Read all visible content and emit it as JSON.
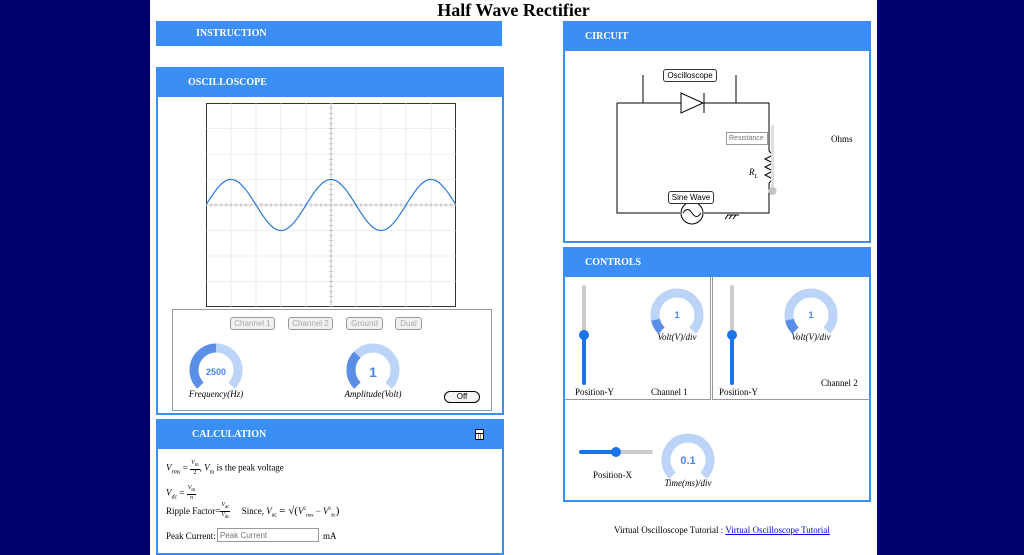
{
  "page_title": "Half Wave Rectifier",
  "instruction": {
    "title": "INSTRUCTION"
  },
  "oscilloscope": {
    "title": "OSCILLOSCOPE",
    "channel_buttons": [
      "Channel 1",
      "Channel 2",
      "Ground",
      "Dual"
    ],
    "frequency": {
      "value": "2500",
      "label": "Frequency(Hz)",
      "level": 0.5
    },
    "amplitude": {
      "value": "1",
      "label": "Amplitude(Volt)",
      "level": 0.33
    },
    "off_label": "Off",
    "waveform": {
      "type": "sine",
      "cycles": 2.5,
      "amplitude_divs": 1
    }
  },
  "calculation": {
    "title": "CALCULATION",
    "line1_var": "V",
    "line1_sub": "rms",
    "line1_num": "V",
    "line1_num_sub": "m",
    "line1_den": "2",
    "line1_rest_var": "V",
    "line1_rest_sub": "m",
    "line1_rest": "is the peak voltage",
    "line2_var": "V",
    "line2_sub": "dc",
    "line2_num": "V",
    "line2_num_sub": "m",
    "line2_den": "π",
    "ripple_label": "Ripple Factor=",
    "ripple_num": "V",
    "ripple_num_sub": "ac",
    "ripple_den": "V",
    "ripple_den_sub": "dc",
    "since": "Since,",
    "since_var": "V",
    "since_sub": "ac",
    "since_eq": "= √(",
    "since_t1": "V",
    "since_t1_sub": "rms",
    "since_t1_sup": "2",
    "since_minus": " − ",
    "since_t2": "V",
    "since_t2_sub": "dc",
    "since_t2_sup": "2",
    "since_close": ")",
    "peak_label": "Peak Current:",
    "peak_placeholder": "Peak Current",
    "peak_unit": "mA"
  },
  "circuit": {
    "title": "CIRCUIT",
    "oscilloscope_label": "Oscilloscope",
    "resistance_placeholder": "Resistance",
    "ohms": "Ohms",
    "rl": "R",
    "rl_sub": "L",
    "sine_label": "Sine Wave"
  },
  "controls": {
    "title": "CONTROLS",
    "ch1": {
      "volt_value": "1",
      "volt_label": "Volt(V)/div",
      "position_label": "Position-Y",
      "channel_label": "Channel 1",
      "position_level": 0.5
    },
    "ch2": {
      "volt_value": "1",
      "volt_label": "Volt(V)/div",
      "position_label": "Position-Y",
      "channel_label": "Channel 2",
      "position_level": 0.5
    },
    "time": {
      "value": "0.1",
      "label": "Time(ms)/div",
      "position_label": "Position-X",
      "position_level": 0.5
    }
  },
  "footer": {
    "text": "Virtual Oscilloscope Tutorial :",
    "link": "Virtual Oscilloscope Tutorial"
  },
  "colors": {
    "accent": "#3a8ef6",
    "background": "#00006e",
    "knob_track": "#bcd4f7",
    "knob_fill": "#5b8ee6",
    "wave": "#2b7bd6"
  }
}
